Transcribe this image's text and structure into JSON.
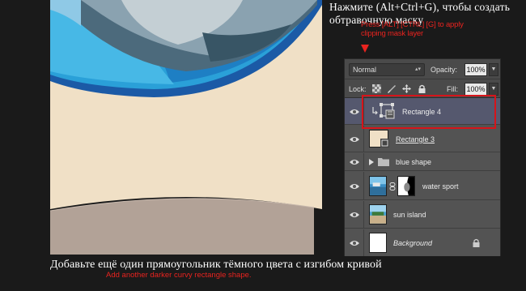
{
  "instructions": {
    "ru_title": "Нажмите (Alt+Ctrl+G), чтобы создать обтравочную маску",
    "en_note": "Press [ALT] [CTRL] [G] to apply clipping mask layer",
    "ru_bottom": "Добавьте ещё один прямоугольник тёмного цвета с изгибом кривой",
    "en_bottom": "Add another darker curvy rectangle shape."
  },
  "colors": {
    "canvas_bg": "#1a1a1a",
    "beige": "#f0e0c6",
    "dark_beige": "#b2a297",
    "blue_dark": "#1b5aa6",
    "blue_light": "#36a8dd",
    "accent_red": "#e8231f",
    "selected_layer": "#55586e"
  },
  "layers_panel": {
    "blend_mode": "Normal",
    "opacity_label": "Opacity:",
    "opacity_value": "100%",
    "lock_label": "Lock:",
    "fill_label": "Fill:",
    "fill_value": "100%",
    "layers": [
      {
        "name": "Rectangle 4",
        "selected": true,
        "clipped": true,
        "thumb": "vector-shape-icon"
      },
      {
        "name": "Rectangle 3",
        "selected": false,
        "thumb": "beige-rectangle"
      },
      {
        "name": "blue shape",
        "selected": false,
        "thumb": "folder-icon",
        "group": true
      },
      {
        "name": "water sport",
        "selected": false,
        "thumb": "photo-with-mask"
      },
      {
        "name": "sun island",
        "selected": false,
        "thumb": "photo"
      },
      {
        "name": "Background",
        "selected": false,
        "thumb": "white",
        "locked": true
      }
    ]
  }
}
